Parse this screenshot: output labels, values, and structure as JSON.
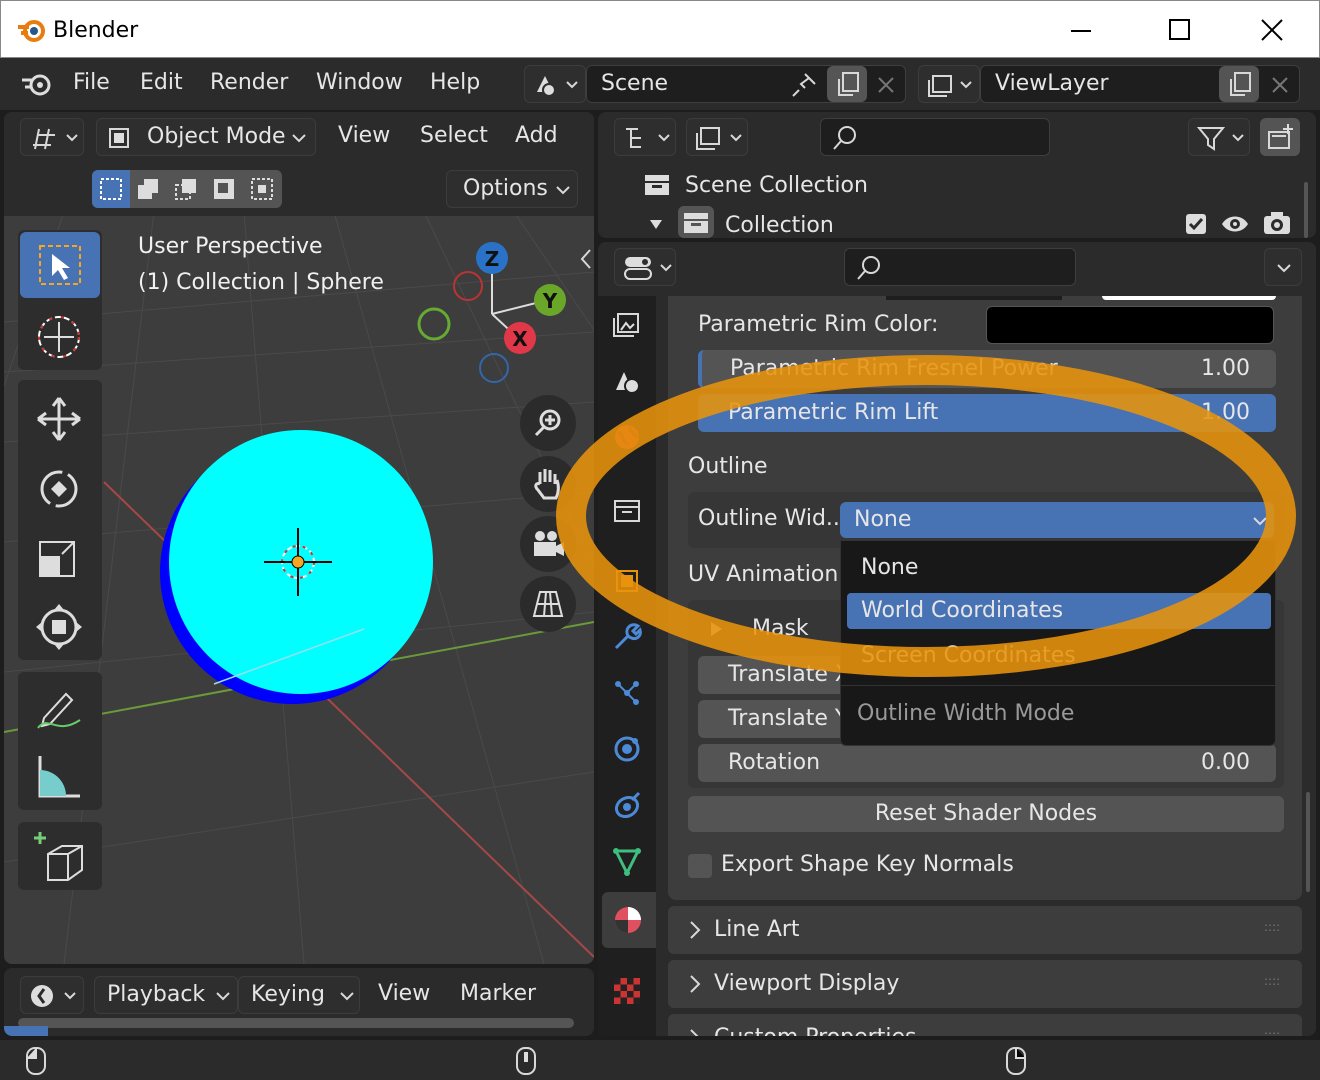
{
  "app": {
    "title": "Blender"
  },
  "menu": {
    "items": [
      "File",
      "Edit",
      "Render",
      "Window",
      "Help"
    ]
  },
  "scene": {
    "name": "Scene"
  },
  "viewlayer": {
    "name": "ViewLayer"
  },
  "viewport_header": {
    "mode": "Object Mode",
    "menus": [
      "View",
      "Select",
      "Add"
    ],
    "options": "Options"
  },
  "viewport": {
    "line1": "User Perspective",
    "line2": "(1) Collection | Sphere",
    "gizmo": {
      "z": "Z",
      "y": "Y",
      "x": "X"
    }
  },
  "outliner": {
    "scene_collection": "Scene Collection",
    "collection": "Collection"
  },
  "properties": {
    "rim_color_label": "Parametric Rim Color:",
    "rim_power_label": "Parametric Rim Fresnel Power",
    "rim_power_value": "1.00",
    "rim_lift_label": "Parametric Rim Lift",
    "rim_lift_value": "1.00",
    "outline_header": "Outline",
    "outline_width_label": "Outline Wid...",
    "outline_width_value": "None",
    "uv_animation": "UV Animation",
    "mask": "Mask",
    "translate_x": "Translate X",
    "translate_y": "Translate Y",
    "rotation_label": "Rotation",
    "rotation_value": "0.00",
    "reset_button": "Reset Shader Nodes",
    "export_checkbox": "Export Shape Key Normals",
    "panels": [
      "Line Art",
      "Viewport Display",
      "Custom Properties"
    ]
  },
  "dropdown": {
    "options": [
      "None",
      "World Coordinates",
      "Screen Coordinates"
    ],
    "selected": "World Coordinates",
    "title": "Outline Width Mode"
  },
  "timeline": {
    "menus": [
      "Playback",
      "Keying",
      "View",
      "Marker"
    ]
  },
  "colors": {
    "accent": "#4772b3",
    "highlight": "#e8930c",
    "sphere": "#00ffff",
    "sphere_dark": "#0000ff"
  }
}
